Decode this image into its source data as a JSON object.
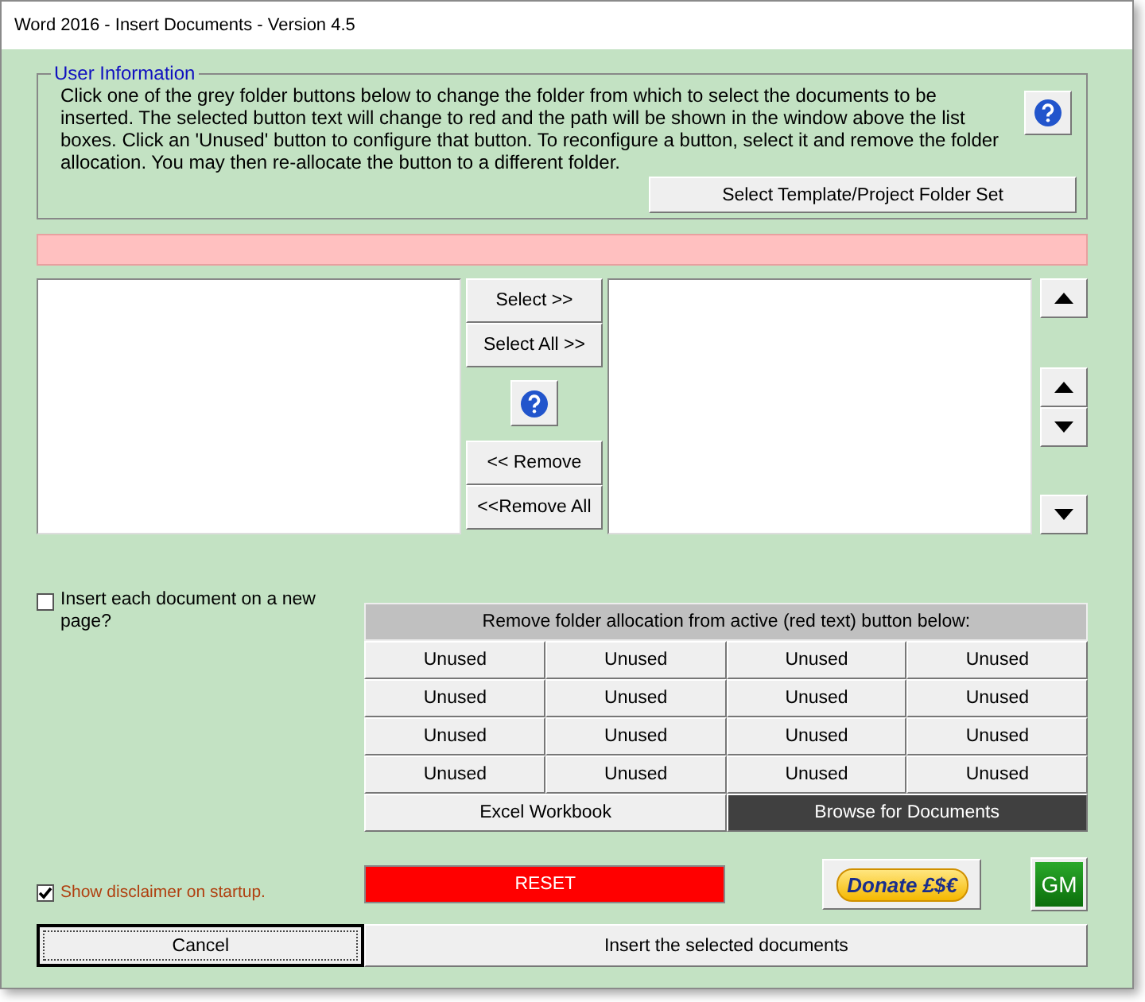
{
  "window": {
    "title": "Word 2016 - Insert Documents - Version 4.5"
  },
  "user_info": {
    "legend": "User Information",
    "text": "Click one of the grey folder buttons below to change the folder from which to select the documents to be inserted. The selected button text will change to red and the path will be shown in the window above the list boxes. Click an 'Unused' button to configure that button. To reconfigure a button, select it and remove the folder allocation. You may then re-allocate the button to a different folder.",
    "template_button": "Select Template/Project Folder Set"
  },
  "transfer_buttons": [
    "Select >>",
    "Select All >>",
    "<< Remove",
    "<<Remove All"
  ],
  "new_page_checkbox": {
    "label": "Insert each document on a new page?",
    "checked": false
  },
  "folder_grid": {
    "header": "Remove folder allocation from active (red text) button below:",
    "buttons": [
      {
        "label": "Unused",
        "active": false
      },
      {
        "label": "Unused",
        "active": false
      },
      {
        "label": "Unused",
        "active": false
      },
      {
        "label": "Unused",
        "active": false
      },
      {
        "label": "Unused",
        "active": false
      },
      {
        "label": "Unused",
        "active": false
      },
      {
        "label": "Unused",
        "active": false
      },
      {
        "label": "Unused",
        "active": false
      },
      {
        "label": "Unused",
        "active": false
      },
      {
        "label": "Unused",
        "active": false
      },
      {
        "label": "Unused",
        "active": false
      },
      {
        "label": "Unused",
        "active": false
      },
      {
        "label": "Unused",
        "active": false
      },
      {
        "label": "Unused",
        "active": false
      },
      {
        "label": "Unused",
        "active": false
      },
      {
        "label": "Unused",
        "active": false
      }
    ],
    "actions": [
      {
        "label": "Excel Workbook",
        "kind": "light"
      },
      {
        "label": "Browse for Documents",
        "kind": "dark"
      }
    ]
  },
  "disclaimer_checkbox": {
    "label": "Show disclaimer on startup.",
    "checked": true
  },
  "reset_button": "RESET",
  "donate_button": "Donate £$€",
  "gm_button": "GM",
  "footer_buttons": [
    "Cancel",
    "Insert the selected documents"
  ]
}
